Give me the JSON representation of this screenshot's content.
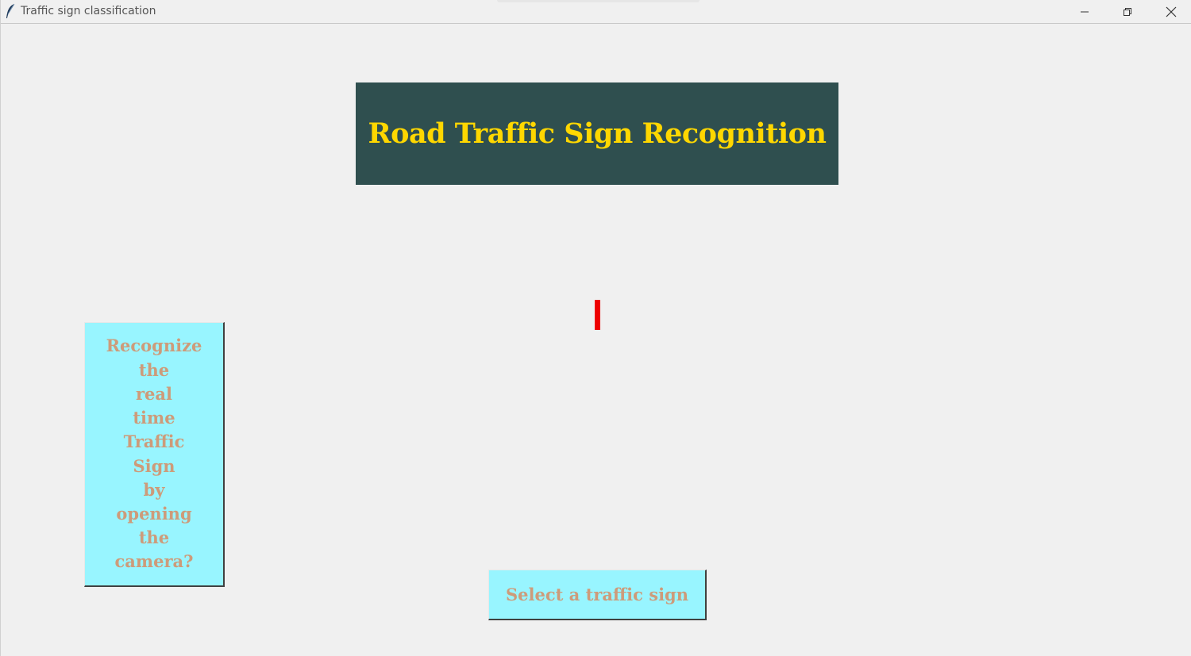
{
  "window": {
    "title": "Traffic sign classification",
    "icon": "feather-icon",
    "controls": {
      "minimize_icon": "minimize-icon",
      "maximize_icon": "restore-icon",
      "close_icon": "close-icon"
    }
  },
  "heading": {
    "text": "Road Traffic Sign Recognition",
    "background": "#2f4f4f",
    "color": "#ffd700"
  },
  "result_label": {
    "text": "",
    "color": "#ee0000"
  },
  "camera_button": {
    "label": "Recognize\nthe\nreal\ntime\nTraffic\nSign\nby\nopening\nthe\ncamera?",
    "background": "#98f5ff",
    "color": "#cd9b7a"
  },
  "select_button": {
    "label": "Select a traffic sign",
    "background": "#98f5ff",
    "color": "#cd9b7a"
  }
}
